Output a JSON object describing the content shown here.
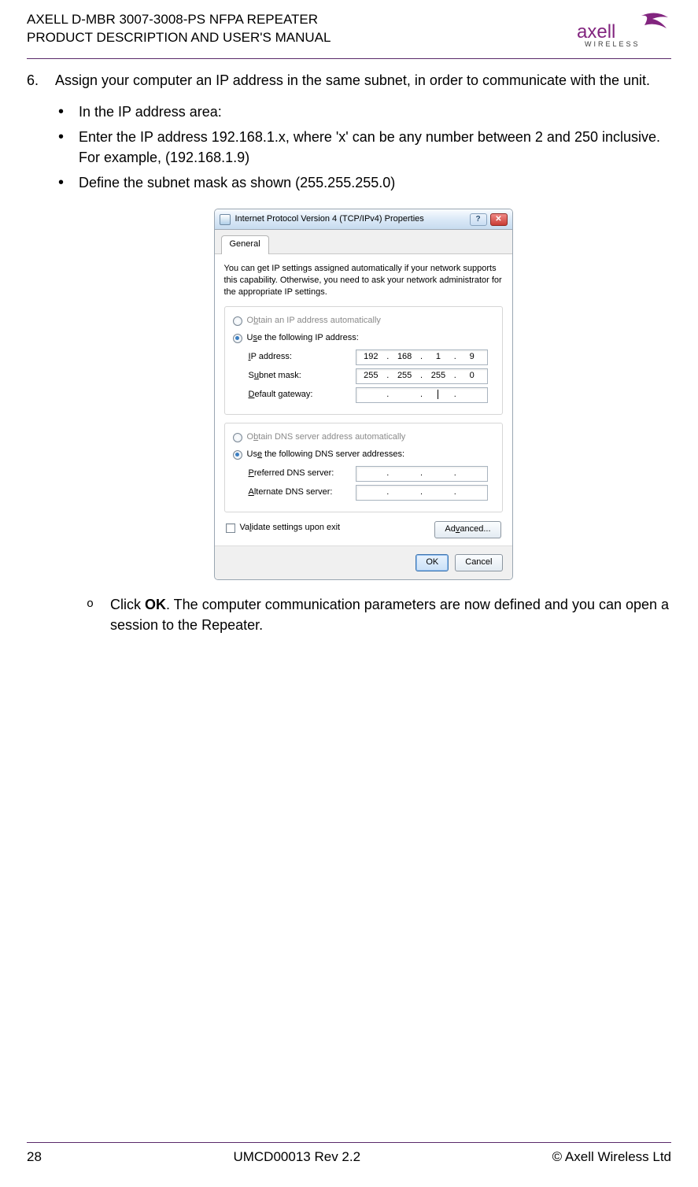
{
  "header": {
    "line1": "AXELL D-MBR 3007-3008-PS NFPA REPEATER",
    "line2": "PRODUCT DESCRIPTION AND USER'S MANUAL",
    "logo_top": "axell",
    "logo_bottom": "WIRELESS"
  },
  "step": {
    "number": "6.",
    "text1": "Assign your computer an IP address in the same subnet, in order to communicate with the unit.",
    "bullets": [
      "In the IP address area:",
      "Enter the IP address 192.168.1.x, where 'x' can be any number between 2 and 250 inclusive. For example,  (192.168.1.9)",
      "Define the subnet mask as shown (255.255.255.0)"
    ],
    "sub_ok": "Click ",
    "sub_ok_bold": "OK",
    "sub_ok_after": ". The computer communication parameters are now defined and you can open a session to the Repeater."
  },
  "dialog": {
    "title": "Internet Protocol Version 4 (TCP/IPv4) Properties",
    "help": "?",
    "close": "✕",
    "tab": "General",
    "desc": "You can get IP settings assigned automatically if your network supports this capability. Otherwise, you need to ask your network administrator for the appropriate IP settings.",
    "radio_obtain_ip": "Obtain an IP address automatically",
    "radio_use_ip": "Use the following IP address:",
    "labels": {
      "ip": "IP address:",
      "subnet": "Subnet mask:",
      "gateway": "Default gateway:",
      "pref_dns": "Preferred DNS server:",
      "alt_dns": "Alternate DNS server:"
    },
    "ip": {
      "a": "192",
      "b": "168",
      "c": "1",
      "d": "9"
    },
    "subnet": {
      "a": "255",
      "b": "255",
      "c": "255",
      "d": "0"
    },
    "gateway": {
      "a": "",
      "b": "",
      "c": "",
      "d": ""
    },
    "radio_obtain_dns": "Obtain DNS server address automatically",
    "radio_use_dns": "Use the following DNS server addresses:",
    "validate": "Validate settings upon exit",
    "btn_advanced": "Advanced...",
    "btn_ok": "OK",
    "btn_cancel": "Cancel"
  },
  "footer": {
    "left": "28",
    "center": "UMCD00013 Rev 2.2",
    "right": "© Axell Wireless Ltd"
  }
}
